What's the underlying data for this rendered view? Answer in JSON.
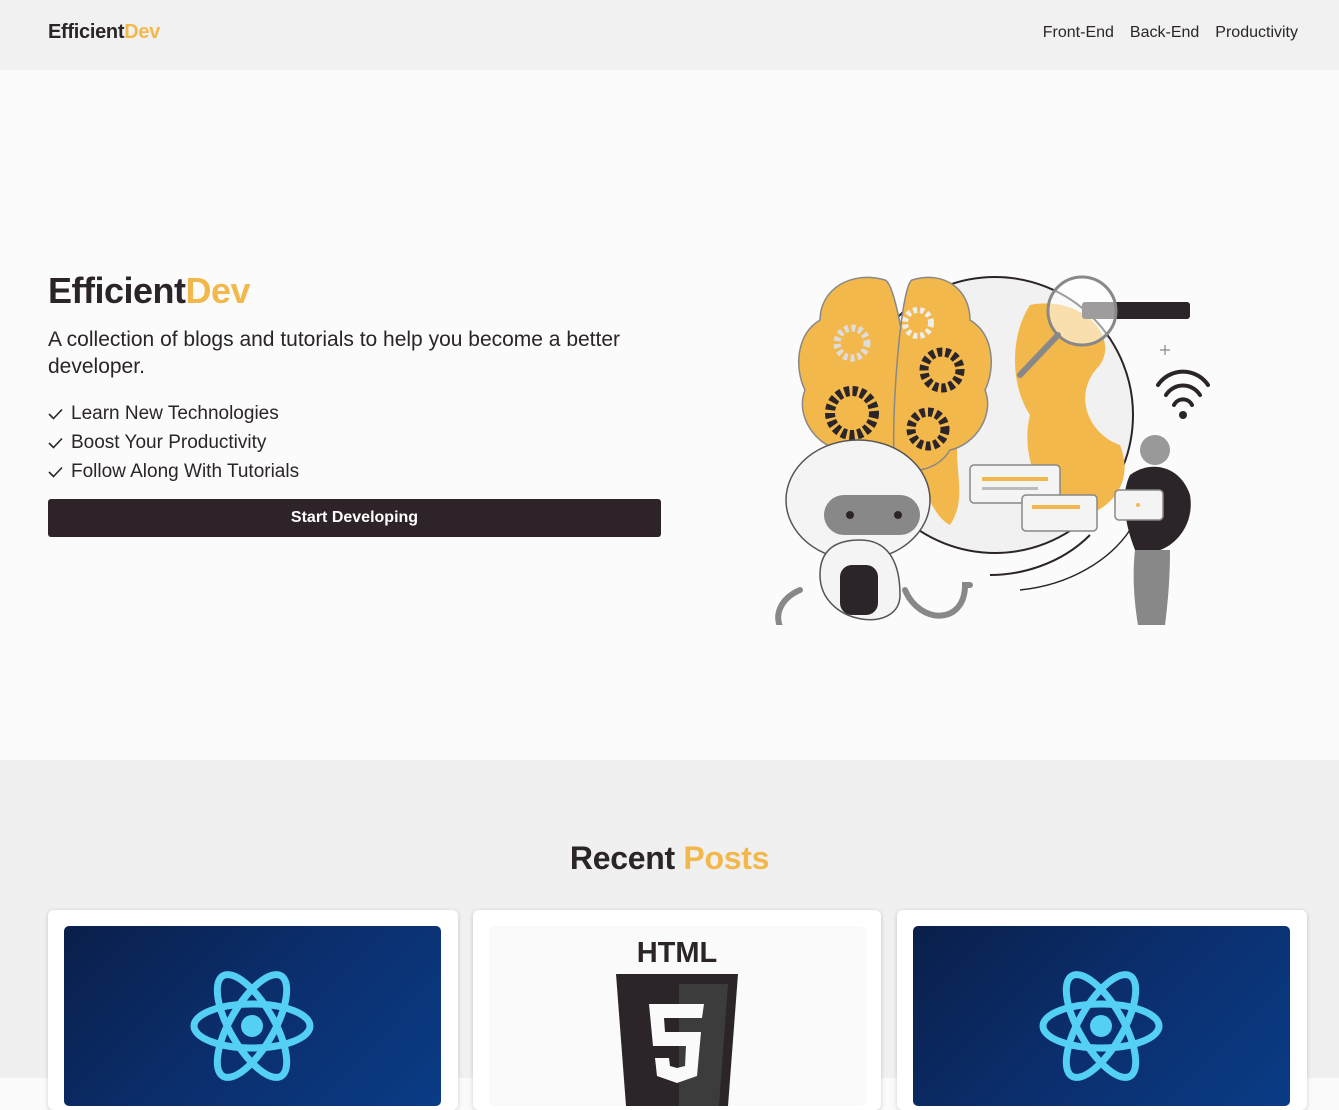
{
  "nav": {
    "brand_part1": "Efficient",
    "brand_part2": "Dev",
    "links": [
      "Front-End",
      "Back-End",
      "Productivity"
    ]
  },
  "hero": {
    "title_part1": "Efficient",
    "title_part2": "Dev",
    "tagline": "A collection of blogs and tutorials to help you become a better developer.",
    "features": [
      "Learn New Technologies",
      "Boost Your Productivity",
      "Follow Along With Tutorials"
    ],
    "cta_label": "Start Developing"
  },
  "recent": {
    "title_part1": "Recent",
    "title_part2": "Posts"
  },
  "posts": [
    {
      "thumbnail": "react-logo"
    },
    {
      "thumbnail": "html5-logo",
      "logo_text": "HTML"
    },
    {
      "thumbnail": "react-logo"
    }
  ],
  "colors": {
    "accent": "#f2b84b",
    "dark": "#2d2329",
    "nav_bg": "#f1f1f1",
    "section_bg": "#f0f0f0"
  }
}
